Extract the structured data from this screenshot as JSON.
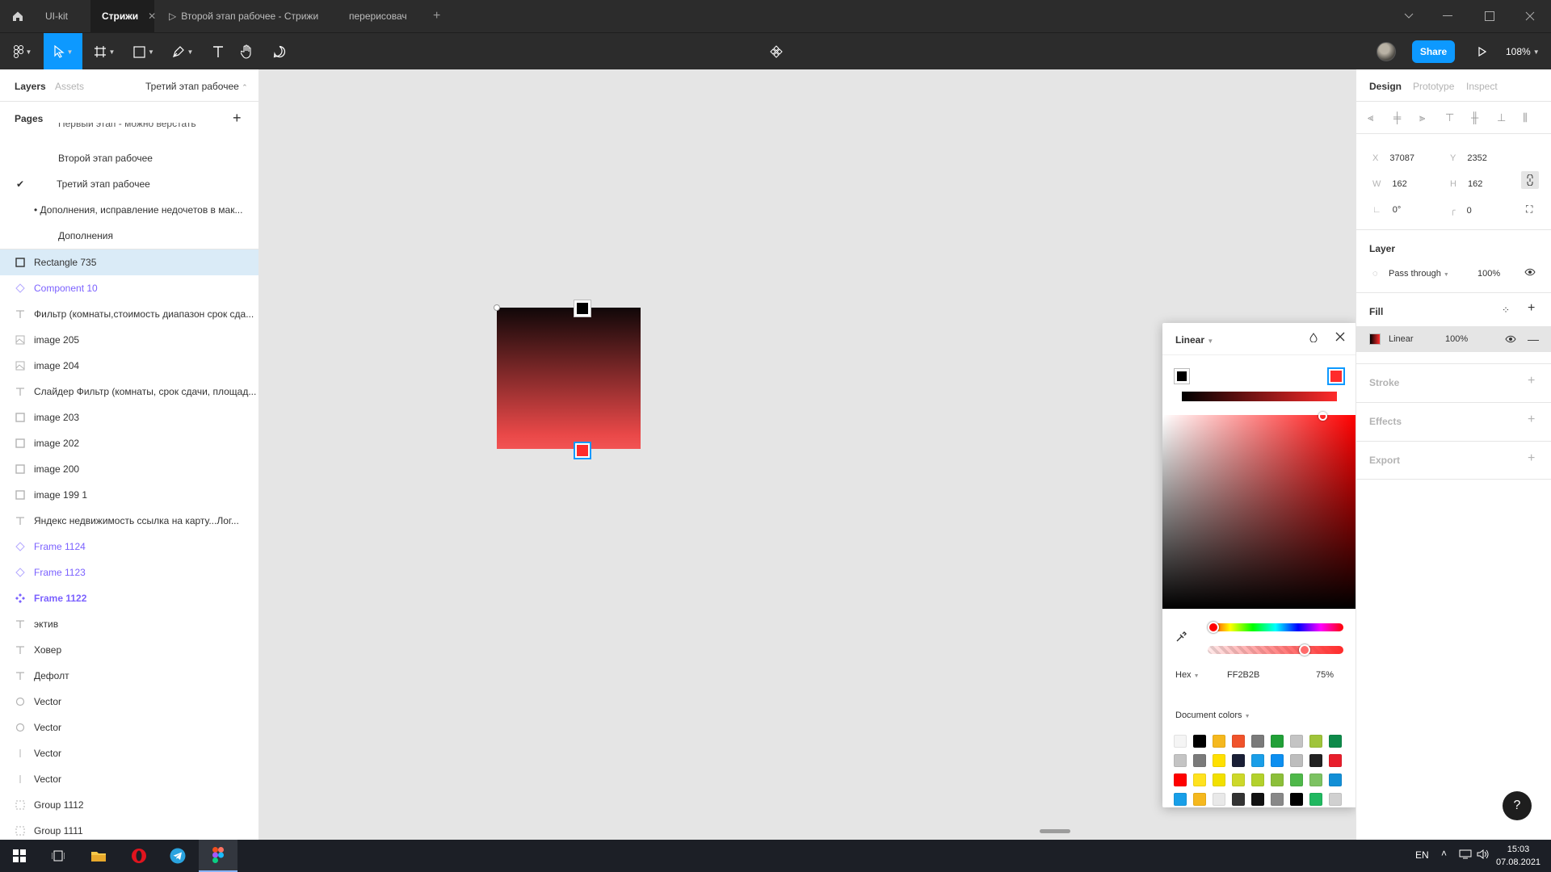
{
  "titlebar": {
    "tabs": [
      {
        "label": "UI-kit"
      },
      {
        "label": "Стрижи",
        "active": true
      },
      {
        "label": "Второй этап рабочее - Стрижи",
        "prefix": "▷"
      },
      {
        "label": "перерисовач"
      }
    ],
    "add_tab": "+"
  },
  "toolbar": {
    "share_label": "Share",
    "zoom_label": "108%"
  },
  "left_panel": {
    "tabs": {
      "layers": "Layers",
      "assets": "Assets"
    },
    "current_page": "Третий этап рабочее",
    "pages_label": "Pages",
    "pages": [
      {
        "label": "Первый этап - можно верстать"
      },
      {
        "label": "Второй этап рабочее"
      },
      {
        "label": "Третий этап рабочее",
        "current": true
      },
      {
        "label": "• Дополнения, исправление недочетов в мак..."
      },
      {
        "label": "Дополнения"
      }
    ],
    "layers": [
      {
        "label": "Rectangle 735",
        "icon": "rect",
        "selected": true
      },
      {
        "label": "Component 10",
        "icon": "component",
        "purple": true
      },
      {
        "label": "Фильтр (комнаты,стоимость диапазон срок сда...",
        "icon": "text"
      },
      {
        "label": "image 205",
        "icon": "image"
      },
      {
        "label": "image 204",
        "icon": "image"
      },
      {
        "label": "Слайдер Фильтр (комнаты, срок сдачи, площад...",
        "icon": "text"
      },
      {
        "label": "image 203",
        "icon": "rect"
      },
      {
        "label": "image 202",
        "icon": "rect"
      },
      {
        "label": "image 200",
        "icon": "rect"
      },
      {
        "label": "image 199 1",
        "icon": "rect"
      },
      {
        "label": "Яндекс недвижимость ссылка на карту...Лог...",
        "icon": "text"
      },
      {
        "label": "Frame 1124",
        "icon": "component",
        "purple": true
      },
      {
        "label": "Frame 1123",
        "icon": "component",
        "purple": true
      },
      {
        "label": "Frame 1122",
        "icon": "main-component",
        "purple": true,
        "bold": true
      },
      {
        "label": "эктив",
        "icon": "text"
      },
      {
        "label": "Ховер",
        "icon": "text"
      },
      {
        "label": "Дефолт",
        "icon": "text"
      },
      {
        "label": "Vector",
        "icon": "ellipse"
      },
      {
        "label": "Vector",
        "icon": "ellipse"
      },
      {
        "label": "Vector",
        "icon": "line"
      },
      {
        "label": "Vector",
        "icon": "line"
      },
      {
        "label": "Group 1112",
        "icon": "group"
      },
      {
        "label": "Group 1111",
        "icon": "group"
      }
    ]
  },
  "picker": {
    "type": "Linear",
    "mode": "Hex",
    "hex": "FF2B2B",
    "opacity": "75%",
    "document_colors_label": "Document colors",
    "swatches": [
      "#f5f5f5",
      "#000000",
      "#f5b81e",
      "#f0532b",
      "#7a7a7a",
      "#21a038",
      "#c4c4c4",
      "#9fc43a",
      "#0e8a4a",
      "#c4c4c4",
      "#7a7a7a",
      "#ffe000",
      "#1a1f36",
      "#1a9ee8",
      "#0d8ff0",
      "#bdbdbd",
      "#222222",
      "#e81e2b",
      "#ff0000",
      "#ffe21f",
      "#f2e000",
      "#cdd82a",
      "#b3d12c",
      "#8cbf3a",
      "#4fb84a",
      "#7cc262",
      "#138fd6",
      "#189fe8",
      "#f5b81e",
      "#e9e9e9",
      "#333333",
      "#111111",
      "#888888",
      "#000000",
      "#20b860",
      "#d0d0d0"
    ]
  },
  "right_panel": {
    "tabs": {
      "design": "Design",
      "prototype": "Prototype",
      "inspect": "Inspect"
    },
    "x_label": "X",
    "x": "37087",
    "y_label": "Y",
    "y": "2352",
    "w_label": "W",
    "w": "162",
    "h_label": "H",
    "h": "162",
    "rotation": "0°",
    "radius": "0",
    "layer_label": "Layer",
    "blend_mode": "Pass through",
    "layer_opacity": "100%",
    "fill_label": "Fill",
    "fill_type": "Linear",
    "fill_opacity": "100%",
    "stroke_label": "Stroke",
    "effects_label": "Effects",
    "export_label": "Export"
  },
  "taskbar": {
    "lang": "EN",
    "time": "15:03",
    "date": "07.08.2021"
  },
  "help_label": "?"
}
